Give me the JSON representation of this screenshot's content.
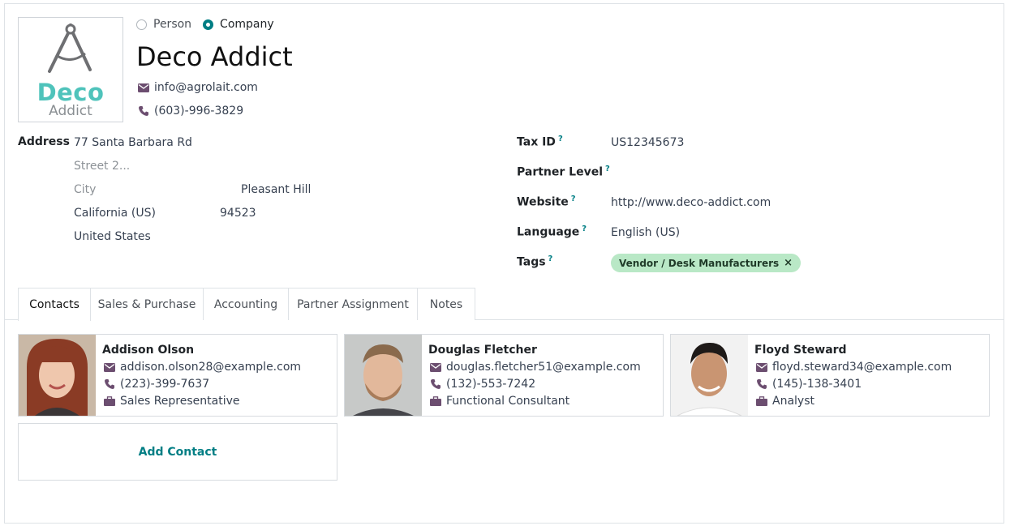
{
  "company_type": {
    "options": [
      {
        "label": "Person",
        "checked": false
      },
      {
        "label": "Company",
        "checked": true
      }
    ]
  },
  "logo": {
    "word1": "Deco",
    "word2": "Addict"
  },
  "company": {
    "name": "Deco Addict",
    "email": "info@agrolait.com",
    "phone": "(603)-996-3829"
  },
  "address": {
    "label": "Address",
    "street": "77 Santa Barbara Rd",
    "street2_placeholder": "Street 2...",
    "city_placeholder": "City",
    "city": "Pleasant Hill",
    "state": "California (US)",
    "zip": "94523",
    "country": "United States"
  },
  "fields": {
    "tax_id": {
      "label": "Tax ID",
      "help": "?",
      "value": "US12345673"
    },
    "partner_level": {
      "label": "Partner Level",
      "help": "?",
      "value": ""
    },
    "website": {
      "label": "Website",
      "help": "?",
      "value": "http://www.deco-addict.com"
    },
    "language": {
      "label": "Language",
      "help": "?",
      "value": "English (US)"
    },
    "tags": {
      "label": "Tags",
      "help": "?",
      "items": [
        {
          "label": "Vendor / Desk Manufacturers",
          "remove": "×",
          "color": "#b9e8c6"
        }
      ]
    }
  },
  "tabs": [
    {
      "label": "Contacts",
      "active": true
    },
    {
      "label": "Sales & Purchase",
      "active": false
    },
    {
      "label": "Accounting",
      "active": false
    },
    {
      "label": "Partner Assignment",
      "active": false
    },
    {
      "label": "Notes",
      "active": false
    }
  ],
  "contacts": [
    {
      "name": "Addison Olson",
      "email": "addison.olson28@example.com",
      "phone": "(223)-399-7637",
      "job": "Sales Representative"
    },
    {
      "name": "Douglas Fletcher",
      "email": "douglas.fletcher51@example.com",
      "phone": "(132)-553-7242",
      "job": "Functional Consultant"
    },
    {
      "name": "Floyd Steward",
      "email": "floyd.steward34@example.com",
      "phone": "(145)-138-3401",
      "job": "Analyst"
    }
  ],
  "add_contact_label": "Add Contact",
  "colors": {
    "accent": "#017e84",
    "icon": "#6c4e70",
    "logo_teal": "#4fc3bb"
  }
}
